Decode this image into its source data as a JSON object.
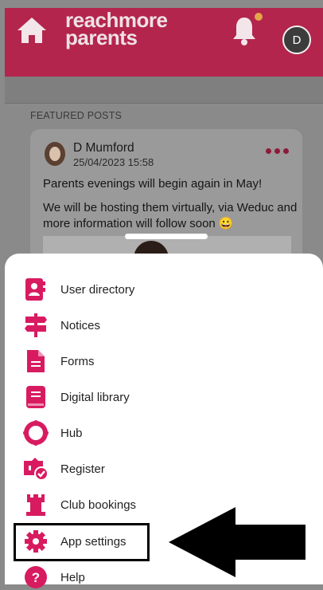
{
  "header": {
    "logo_line1": "reachmore",
    "logo_line2": "parents",
    "avatar_initial": "D",
    "brand_color": "#b3254c",
    "notification_dot_color": "#e3a64a"
  },
  "feed": {
    "section_title": "FEATURED POSTS",
    "post": {
      "author": "D Mumford",
      "date": "25/04/2023 15:58",
      "line1": "Parents evenings will begin again in May!",
      "line2": "We will be hosting them virtually, via Weduc and more information will follow soon 😀"
    }
  },
  "menu": {
    "items": [
      {
        "label": "User directory",
        "icon": "user-directory-icon"
      },
      {
        "label": "Notices",
        "icon": "signpost-icon"
      },
      {
        "label": "Forms",
        "icon": "document-icon"
      },
      {
        "label": "Digital library",
        "icon": "book-icon"
      },
      {
        "label": "Hub",
        "icon": "hub-icon"
      },
      {
        "label": "Register",
        "icon": "register-icon"
      },
      {
        "label": "Club bookings",
        "icon": "castle-icon"
      },
      {
        "label": "App settings",
        "icon": "gear-icon"
      },
      {
        "label": "Help",
        "icon": "help-icon"
      }
    ],
    "icon_color": "#d81b60"
  }
}
